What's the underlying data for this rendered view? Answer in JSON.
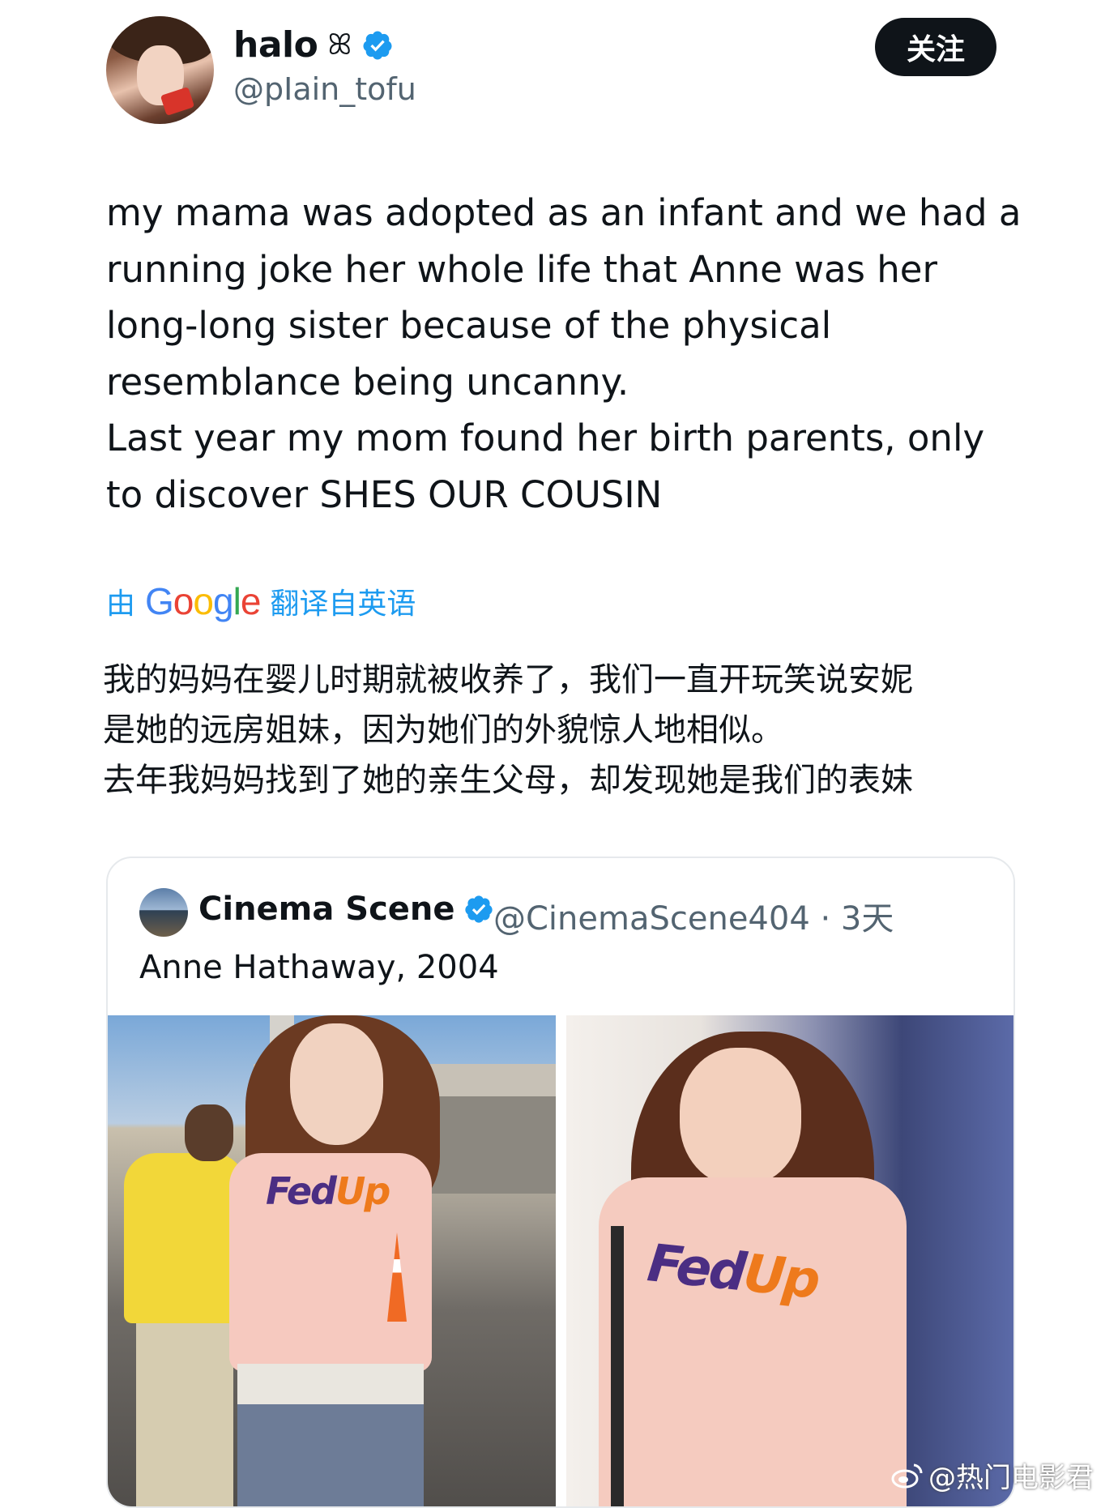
{
  "author": {
    "display_name": "halo",
    "name_glyph": "ꕤ",
    "handle": "@pIain_tofu",
    "verified": true,
    "avatar_icon": "profile-photo"
  },
  "follow_button": {
    "label": "关注"
  },
  "tweet": {
    "text": "my mama was adopted as an infant and we had a\nrunning joke her whole life that Anne was her\nlong-long sister because of the physical\nresemblance being uncanny.\nLast year my mom found her birth parents, only\nto discover SHES OUR COUSIN"
  },
  "translation": {
    "prefix": "由",
    "provider_letters": [
      "G",
      "o",
      "o",
      "g",
      "l",
      "e"
    ],
    "suffix": "翻译自英语",
    "text": "我的妈妈在婴儿时期就被收养了，我们一直开玩笑说安妮\n是她的远房姐妹，因为她们的外貌惊人地相似。\n去年我妈妈找到了她的亲生父母，却发现她是我们的表妹"
  },
  "quote": {
    "display_name": "Cinema Scene",
    "verified": true,
    "handle_time": "@CinemaScene404 · 3天",
    "text": "Anne Hathaway, 2004",
    "photos": [
      {
        "shirt_text_a": "Fed",
        "shirt_text_b": "Up"
      },
      {
        "shirt_text_a": "Fed",
        "shirt_text_b": "Up"
      }
    ]
  },
  "watermark": {
    "text": "@热门电影君",
    "icon": "weibo-logo-icon"
  },
  "colors": {
    "accent": "#1d9bf0",
    "text": "#0f1419",
    "muted": "#536471",
    "fedex_purple": "#4b2e83",
    "fedex_orange": "#ee7a1c"
  }
}
